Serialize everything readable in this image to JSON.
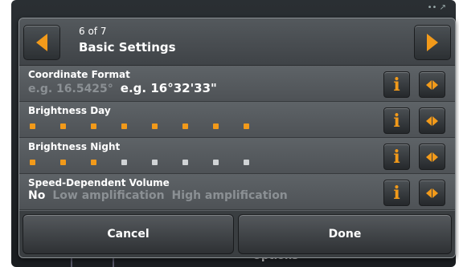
{
  "background": {
    "status_icons": "•• ↗",
    "options_label": "Options"
  },
  "header": {
    "page_indicator": "6 of 7",
    "title": "Basic Settings",
    "prev_icon": "arrow-left-icon",
    "next_icon": "arrow-right-icon"
  },
  "settings": [
    {
      "title": "Coordinate Format",
      "options": [
        {
          "label": "e.g. 16.5425°",
          "selected": false
        },
        {
          "label": "e.g. 16°32'33\"",
          "selected": true
        }
      ]
    },
    {
      "title": "Brightness Day",
      "level": 8,
      "max": 8
    },
    {
      "title": "Brightness Night",
      "level": 3,
      "max": 8
    },
    {
      "title": "Speed-Dependent Volume",
      "options": [
        {
          "label": "No",
          "selected": true
        },
        {
          "label": "Low amplification",
          "selected": false
        },
        {
          "label": "High amplification",
          "selected": false
        }
      ]
    }
  ],
  "row_buttons": {
    "info_icon": "info-icon",
    "toggle_icon": "left-right-arrows-icon",
    "info_glyph": "i"
  },
  "footer": {
    "cancel_label": "Cancel",
    "done_label": "Done"
  },
  "colors": {
    "accent": "#f29a1a",
    "inactive_level": "#d0d3d5",
    "selected_text": "#ffffff",
    "unselected_text": "#8b9094"
  }
}
